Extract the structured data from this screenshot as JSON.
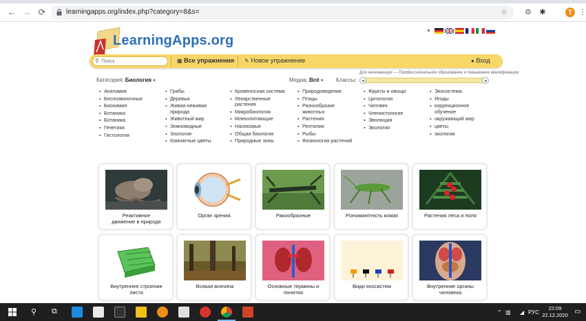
{
  "browser": {
    "url": "learningapps.org/index.php?category=8&s=",
    "profile_initial": "T"
  },
  "site": {
    "logo": "LearningApps.org",
    "search_placeholder": "Поиск",
    "nav": {
      "all_exercises": "Все упражнения",
      "new_exercise": "Новое упражнение",
      "login": "Вход"
    },
    "filters": {
      "category_label": "Категория:",
      "category_value": "Биология",
      "media_label": "Медиа:",
      "media_value": "Всё",
      "classes_label": "Классы:",
      "grade_description": "Для начинающих — Профессиональное образование и повышение квалификации",
      "grade_range": [
        0,
        1
      ]
    }
  },
  "categories": [
    [
      "Анатомия",
      "Беспозвоночные",
      "Биохимия",
      "Ботаника",
      "Ботаника",
      "Генетика",
      "Гистология"
    ],
    [
      "Грибы",
      "Деревья",
      "Живая-неживая\nприрода",
      "Животный мир",
      "Земноводные",
      "Зоология",
      "Комнатные цветы"
    ],
    [
      "Кровеносная система",
      "Лекарственные\nрастения",
      "Микробиология",
      "Млекопитающие",
      "Насекомые",
      "Общая биология",
      "Природные зоны"
    ],
    [
      "Природоведение",
      "Птицы",
      "Разнообразие\nживотных",
      "Растения",
      "Рептилии",
      "Рыбы",
      "Физиология растений"
    ],
    [
      "Фрукты и овощи",
      "Цитология",
      "Человек",
      "Членистоногие",
      "Эволюция",
      "Экология"
    ],
    [
      "Экосистема",
      "Ягоды",
      "коррекционное\nобучение",
      "окружающий мир",
      "цветы",
      "экология"
    ]
  ],
  "cards": [
    {
      "title": "Реактивное\nдвижение в природе",
      "thumb": "octopus"
    },
    {
      "title": "Орган зрения.",
      "thumb": "eye"
    },
    {
      "title": "Ракообразные",
      "thumb": "crayfish"
    },
    {
      "title": "Різноманітність комах",
      "thumb": "grasshopper"
    },
    {
      "title": "Растения леса и поля",
      "thumb": "berries"
    },
    {
      "title": "Внутреннее строение\nлиста",
      "thumb": "leaf-diagram"
    },
    {
      "title": "Всякая всячина",
      "thumb": "forest"
    },
    {
      "title": "Основные термины и\nпонятия",
      "thumb": "kidneys"
    },
    {
      "title": "Види екосистем",
      "thumb": "ecosystems"
    },
    {
      "title": "Внутренние органы\nчеловека",
      "thumb": "organs"
    }
  ],
  "taskbar": {
    "lang": "РУС",
    "time": "22:09",
    "date": "22.12.2020"
  },
  "colors": {
    "accent_yellow": "#f7d767",
    "logo_blue": "#2d6fb5",
    "taskbar": "#1f1f1f"
  }
}
